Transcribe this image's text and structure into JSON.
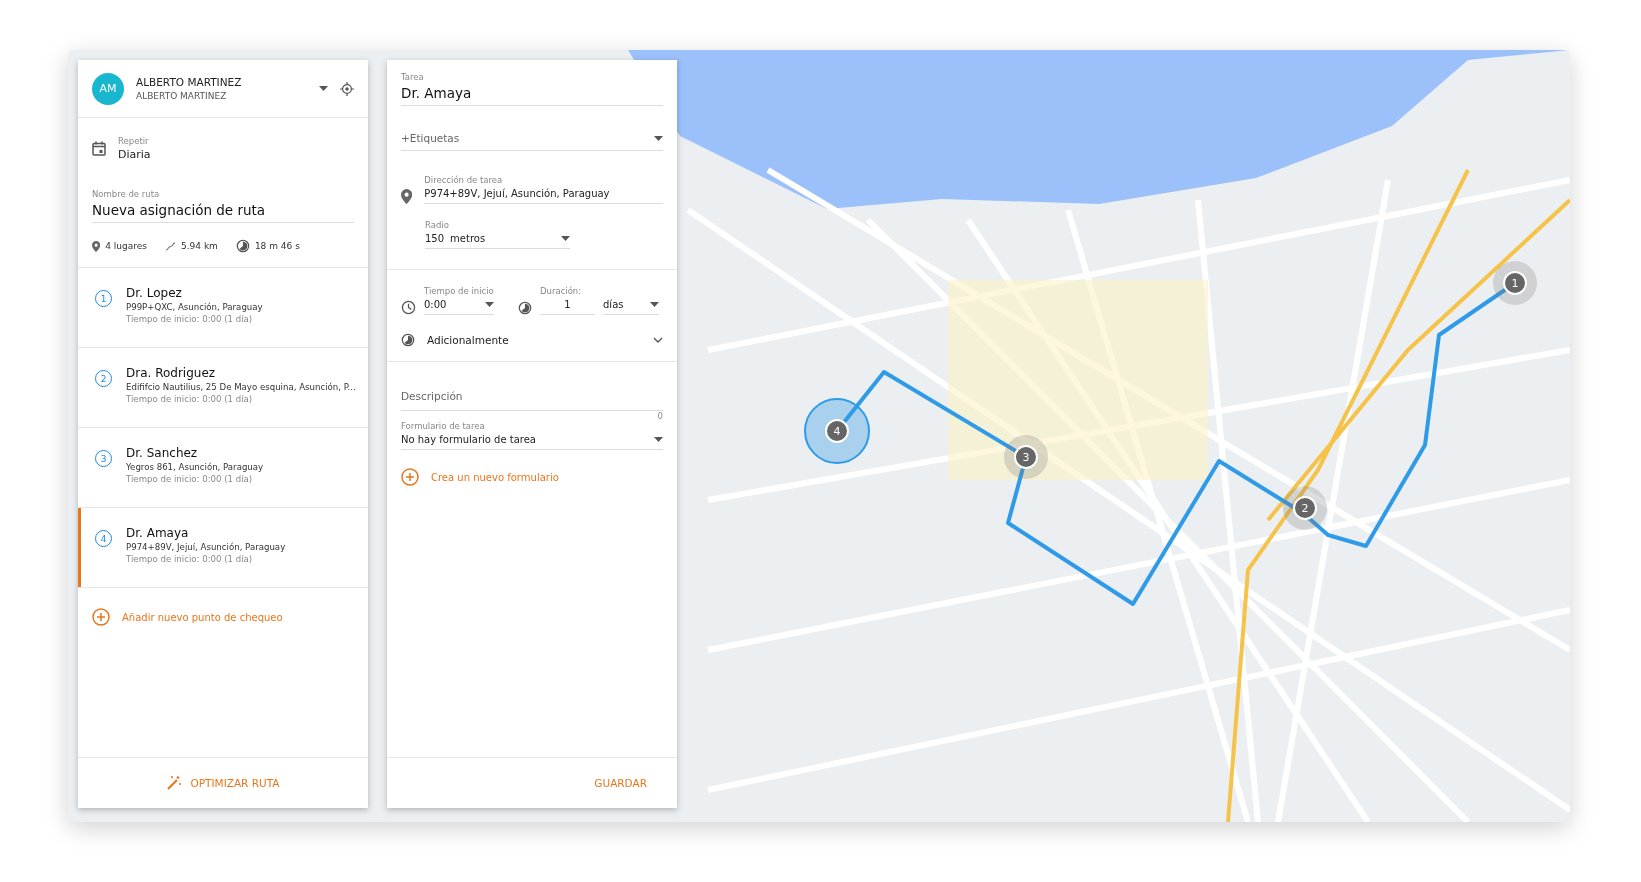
{
  "route_panel": {
    "user": {
      "initials": "AM",
      "name": "ALBERTO MARTINEZ",
      "subtitle": "ALBERTO MARTINEZ"
    },
    "repeat": {
      "label": "Repetir",
      "value": "Diaria"
    },
    "route_name": {
      "label": "Nombre de ruta",
      "value": "Nueva asignación de ruta"
    },
    "stats": [
      {
        "kind": "places",
        "text": "4 lugares"
      },
      {
        "kind": "distance",
        "text": "5.94 km"
      },
      {
        "kind": "duration",
        "text": "18 m 46 s"
      }
    ],
    "stops": [
      {
        "number": "1",
        "name": "Dr. Lopez",
        "address": "P99P+QXC, Asunción, Paraguay",
        "time": "Tiempo de inicio: 0:00 (1 día)",
        "selected": false
      },
      {
        "number": "2",
        "name": "Dra. Rodriguez",
        "address": "Edififcio Nautilius, 25 De Mayo esquina, Asunción, P...",
        "time": "Tiempo de inicio: 0:00 (1 día)",
        "selected": false
      },
      {
        "number": "3",
        "name": "Dr. Sanchez",
        "address": "Yegros 861, Asunción, Paraguay",
        "time": "Tiempo de inicio: 0:00 (1 día)",
        "selected": false
      },
      {
        "number": "4",
        "name": "Dr. Amaya",
        "address": "P974+89V, Jejuí, Asunción, Paraguay",
        "time": "Tiempo de inicio: 0:00 (1 día)",
        "selected": true
      }
    ],
    "add_checkpoint": "Añadir nuevo punto de chequeo",
    "optimize_button": "OPTIMIZAR RUTA"
  },
  "task_panel": {
    "task": {
      "label": "Tarea",
      "value": "Dr. Amaya"
    },
    "tags": {
      "placeholder": "+Etiquetas"
    },
    "address": {
      "label": "Dirección de tarea",
      "value": "P974+89V, Jejuí, Asunción, Paraguay"
    },
    "radius": {
      "label": "Radio",
      "value": "150",
      "unit": "metros"
    },
    "start_time": {
      "label": "Tiempo de inicio",
      "value": "0:00"
    },
    "duration": {
      "label": "Duración:",
      "value": "1",
      "unit": "días"
    },
    "additional": {
      "label": "Adicionalmente",
      "expanded": false
    },
    "description": {
      "placeholder": "Descripción",
      "counter": "0"
    },
    "form": {
      "label": "Formulario de tarea",
      "value": "No hay formulario de tarea"
    },
    "new_form": "Crea un nuevo formulario",
    "save_button": "GUARDAR"
  },
  "map": {
    "markers": [
      {
        "label": "1",
        "selected": false
      },
      {
        "label": "2",
        "selected": false
      },
      {
        "label": "3",
        "selected": false
      },
      {
        "label": "4",
        "selected": true
      }
    ]
  }
}
